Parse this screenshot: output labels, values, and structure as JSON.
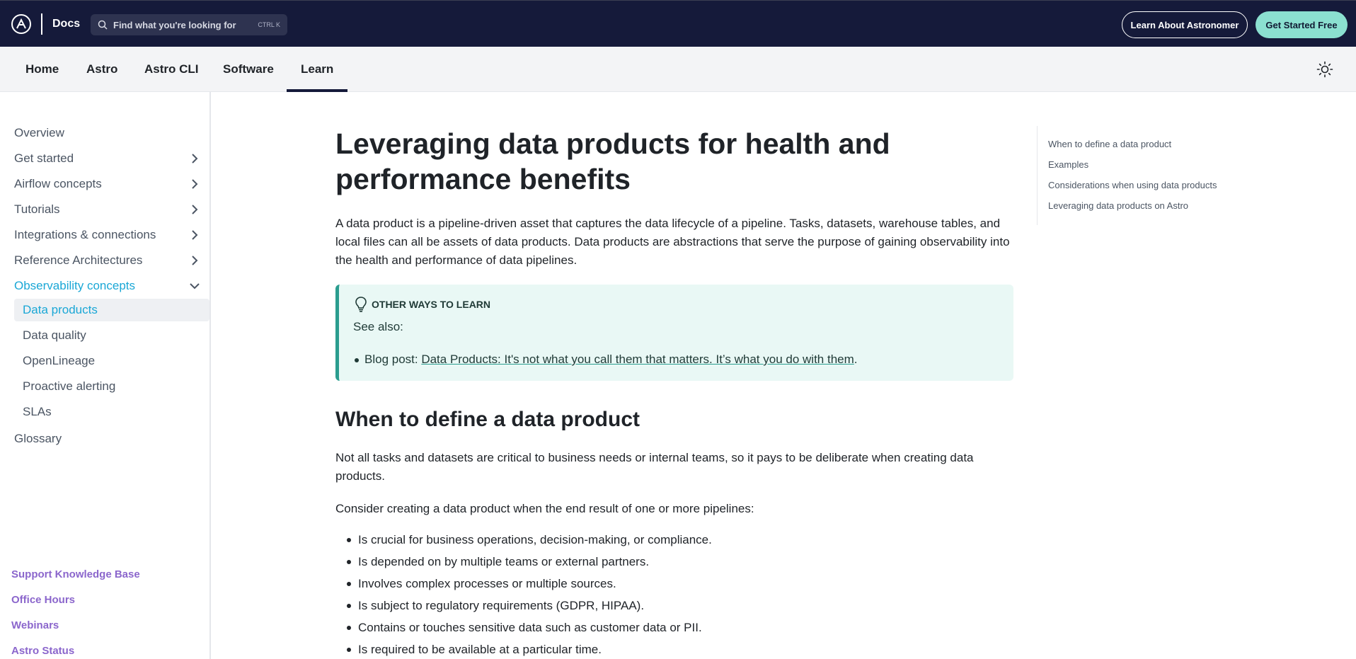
{
  "header": {
    "docs_label": "Docs",
    "search_placeholder": "Find what you're looking for",
    "search_shortcut": "CTRL K",
    "learn_button": "Learn About Astronomer",
    "start_button": "Get Started Free"
  },
  "subnav": {
    "tabs": [
      "Home",
      "Astro",
      "Astro CLI",
      "Software",
      "Learn"
    ],
    "active_tab": "Learn"
  },
  "sidebar": {
    "items": [
      {
        "label": "Overview"
      },
      {
        "label": "Get started"
      },
      {
        "label": "Airflow concepts"
      },
      {
        "label": "Tutorials"
      },
      {
        "label": "Integrations & connections"
      },
      {
        "label": "Reference Architectures"
      },
      {
        "label": "Observability concepts"
      }
    ],
    "sub_items": [
      {
        "label": "Data products"
      },
      {
        "label": "Data quality"
      },
      {
        "label": "OpenLineage"
      },
      {
        "label": "Proactive alerting"
      },
      {
        "label": "SLAs"
      }
    ],
    "glossary": "Glossary",
    "footer_links": [
      "Support Knowledge Base",
      "Office Hours",
      "Webinars",
      "Astro Status"
    ]
  },
  "main": {
    "title": "Leveraging data products for health and performance benefits",
    "intro": "A data product is a pipeline-driven asset that captures the data lifecycle of a pipeline. Tasks, datasets, warehouse tables, and local files can all be assets of data products. Data products are abstractions that serve the purpose of gaining observability into the health and performance of data pipelines.",
    "callout": {
      "heading": "OTHER WAYS TO LEARN",
      "see_also": "See also:",
      "item_prefix": "Blog post: ",
      "item_link": "Data Products: It's not what you call them that matters. It’s what you do with them",
      "item_suffix": "."
    },
    "section_heading": "When to define a data product",
    "section_para1": "Not all tasks and datasets are critical to business needs or internal teams, so it pays to be deliberate when creating data products.",
    "section_para2": "Consider creating a data product when the end result of one or more pipelines:",
    "bullets": [
      "Is crucial for business operations, decision-making, or compliance.",
      "Is depended on by multiple teams or external partners.",
      "Involves complex processes or multiple sources.",
      "Is subject to regulatory requirements (GDPR, HIPAA).",
      "Contains or touches sensitive data such as customer data or PII.",
      "Is required to be available at a particular time."
    ]
  },
  "toc": {
    "items": [
      "When to define a data product",
      "Examples",
      "Considerations when using data products",
      "Leveraging data products on Astro"
    ]
  },
  "colors": {
    "header_bg": "#151a3a",
    "accent_teal": "#8be0d0",
    "active_link": "#1aa7d6",
    "footer_link": "#8b66cc"
  }
}
